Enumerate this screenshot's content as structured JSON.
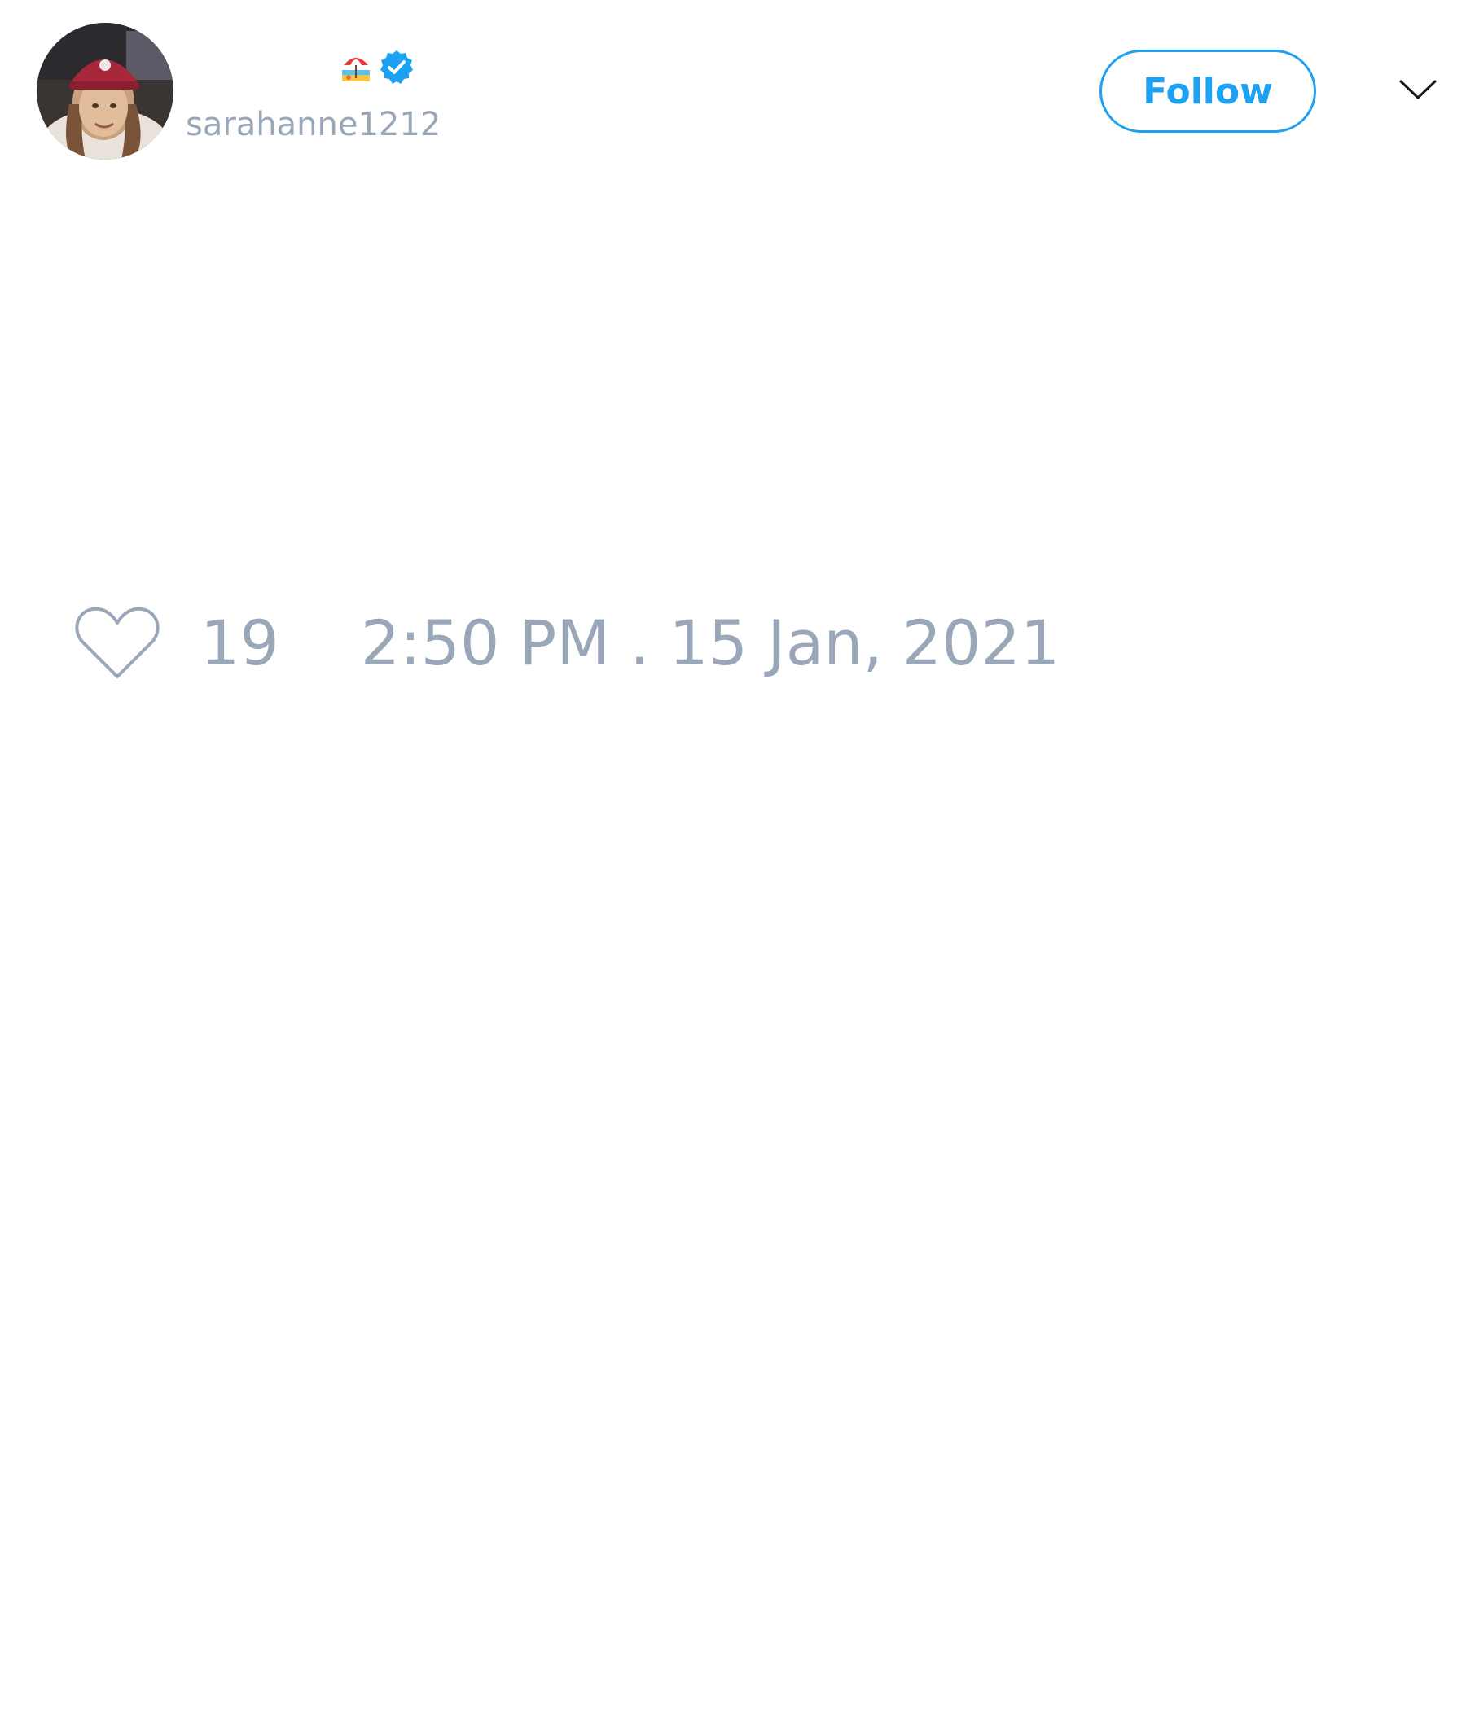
{
  "tweet": {
    "author": {
      "display_name": "",
      "handle": "sarahanne1212",
      "avatar_icon": "user-avatar-photo",
      "name_emoji_icon": "beach-umbrella-icon",
      "verified_icon": "verified-badge-icon",
      "verified": true
    },
    "follow_label": "Follow",
    "menu_icon": "chevron-down-icon",
    "like_icon": "heart-icon",
    "like_count": "19",
    "timestamp": "2:50 PM . 15 Jan, 2021"
  },
  "colors": {
    "accent": "#1da1f2",
    "muted_text": "#9aa7b9",
    "background": "#ffffff"
  }
}
